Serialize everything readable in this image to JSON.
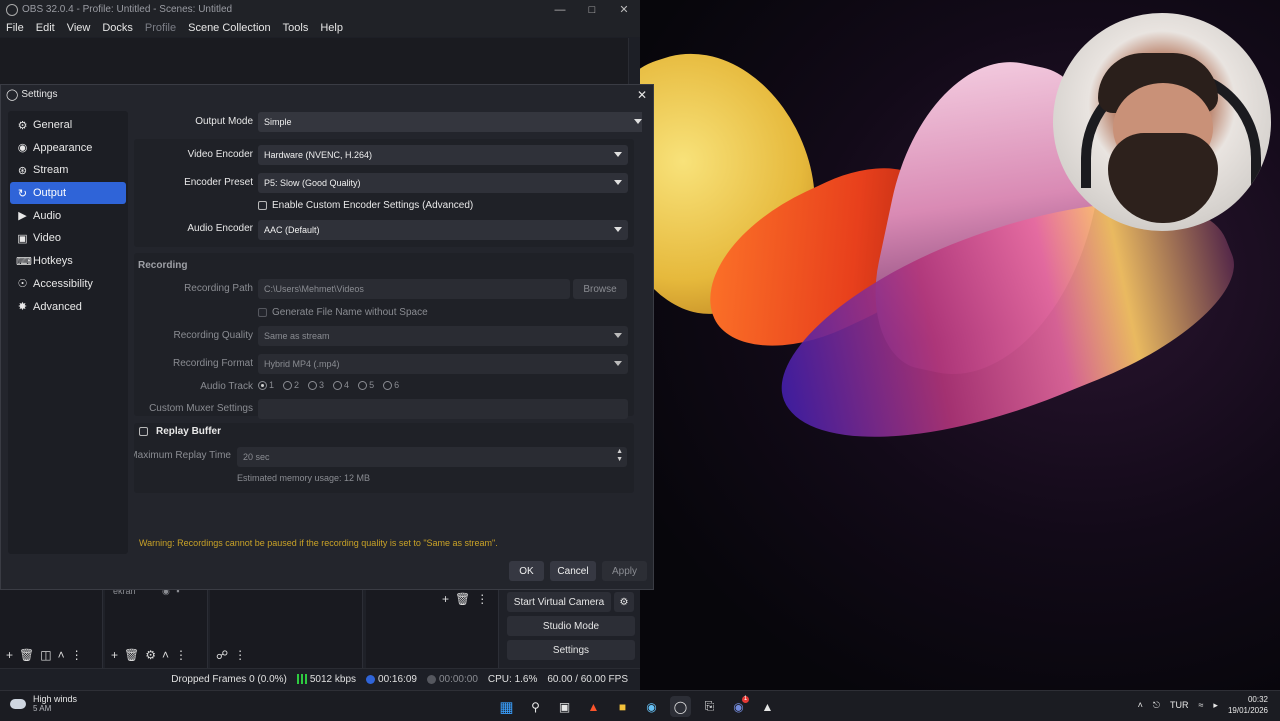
{
  "obs": {
    "window_title": "OBS 32.0.4 - Profile: Untitled - Scenes: Untitled",
    "menu": [
      "File",
      "Edit",
      "View",
      "Docks",
      "Profile",
      "Scene Collection",
      "Tools",
      "Help"
    ],
    "source_item": "ekran",
    "controls": {
      "virtual_camera": "Start Virtual Camera",
      "studio_mode": "Studio Mode",
      "settings": "Settings"
    },
    "status": {
      "dropped_frames": "Dropped Frames 0 (0.0%)",
      "bitrate": "5012 kbps",
      "stream_time": "00:16:09",
      "rec_time": "00:00:00",
      "cpu": "CPU: 1.6%",
      "fps": "60.00 / 60.00 FPS"
    }
  },
  "settings": {
    "title": "Settings",
    "sidebar": [
      {
        "label": "General",
        "icon": "gear-icon"
      },
      {
        "label": "Appearance",
        "icon": "palette-icon"
      },
      {
        "label": "Stream",
        "icon": "antenna-icon"
      },
      {
        "label": "Output",
        "icon": "output-icon"
      },
      {
        "label": "Audio",
        "icon": "speaker-icon"
      },
      {
        "label": "Video",
        "icon": "monitor-icon"
      },
      {
        "label": "Hotkeys",
        "icon": "keyboard-icon"
      },
      {
        "label": "Accessibility",
        "icon": "accessibility-icon"
      },
      {
        "label": "Advanced",
        "icon": "wrench-icon"
      }
    ],
    "active_item": "Output",
    "output_mode": {
      "label": "Output Mode",
      "value": "Simple"
    },
    "streaming": {
      "video_encoder": {
        "label": "Video Encoder",
        "value": "Hardware (NVENC, H.264)"
      },
      "encoder_preset": {
        "label": "Encoder Preset",
        "value": "P5: Slow (Good Quality)"
      },
      "custom_encoder": {
        "label": "Enable Custom Encoder Settings (Advanced)",
        "checked": false
      },
      "audio_encoder": {
        "label": "Audio Encoder",
        "value": "AAC (Default)"
      }
    },
    "recording": {
      "title": "Recording",
      "path": {
        "label": "Recording Path",
        "value": "C:\\Users\\Mehmet\\Videos"
      },
      "browse": "Browse",
      "no_space": {
        "label": "Generate File Name without Space",
        "checked": false
      },
      "quality": {
        "label": "Recording Quality",
        "value": "Same as stream"
      },
      "format": {
        "label": "Recording Format",
        "value": "Hybrid MP4 (.mp4)"
      },
      "audio_track": {
        "label": "Audio Track",
        "tracks": [
          "1",
          "2",
          "3",
          "4",
          "5",
          "6"
        ],
        "selected": "1"
      },
      "muxer": {
        "label": "Custom Muxer Settings",
        "value": ""
      }
    },
    "replay_buffer": {
      "label": "Replay Buffer",
      "checked": false,
      "max_time": {
        "label": "Maximum Replay Time",
        "value": "20 sec"
      },
      "memory": "Estimated memory usage: 12 MB"
    },
    "warning": "Warning: Recordings cannot be paused if the recording quality is set to \"Same as stream\".",
    "buttons": {
      "ok": "OK",
      "cancel": "Cancel",
      "apply": "Apply"
    }
  },
  "taskbar": {
    "weather_title": "High winds",
    "weather_sub": "5 AM",
    "language": "TUR",
    "time": "00:32",
    "date": "19/01/2026",
    "discord_badge": "1"
  }
}
